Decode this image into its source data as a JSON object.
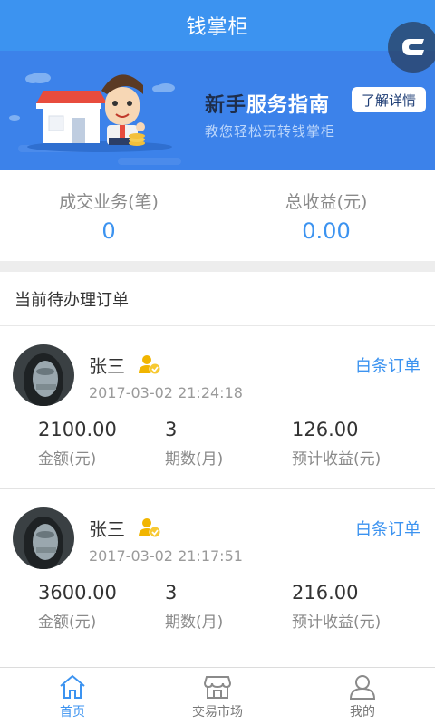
{
  "header": {
    "title": "钱掌柜"
  },
  "banner": {
    "title_prefix": "新手",
    "title_highlight": "服务指南",
    "subtitle": "教您轻松玩转钱掌柜",
    "button_label": "了解详情"
  },
  "stats": [
    {
      "label": "成交业务(笔)",
      "value": "0"
    },
    {
      "label": "总收益(元)",
      "value": "0.00"
    }
  ],
  "section": {
    "title": "当前待办理订单"
  },
  "orders": [
    {
      "name": "张三",
      "type": "白条订单",
      "time": "2017-03-02 21:24:18",
      "amount": "2100.00",
      "amount_label": "金额(元)",
      "periods": "3",
      "periods_label": "期数(月)",
      "income": "126.00",
      "income_label": "预计收益(元)"
    },
    {
      "name": "张三",
      "type": "白条订单",
      "time": "2017-03-02 21:17:51",
      "amount": "3600.00",
      "amount_label": "金额(元)",
      "periods": "3",
      "periods_label": "期数(月)",
      "income": "216.00",
      "income_label": "预计收益(元)"
    }
  ],
  "tabs": [
    {
      "label": "首页",
      "icon": "home-icon",
      "active": true
    },
    {
      "label": "交易市场",
      "icon": "market-icon",
      "active": false
    },
    {
      "label": "我的",
      "icon": "person-icon",
      "active": false
    }
  ],
  "colors": {
    "primary": "#3c93f0",
    "banner": "#3c82ea",
    "text": "#333333",
    "muted": "#8a8a8a"
  }
}
